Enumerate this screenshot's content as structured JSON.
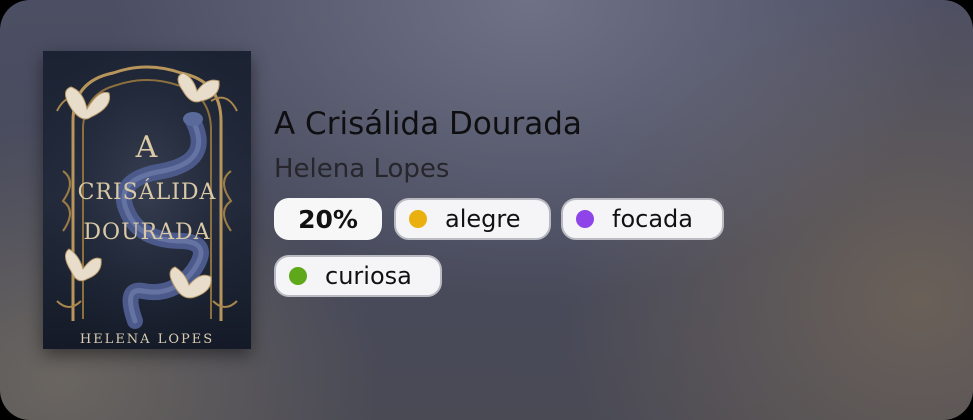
{
  "book": {
    "title": "A Crisálida Dourada",
    "author": "Helena Lopes",
    "cover": {
      "title_line1": "A",
      "title_line2": "CRISÁLIDA",
      "title_line3": "DOURADA",
      "author": "HELENA LOPES"
    }
  },
  "progress": {
    "label": "20%",
    "value": 0.2
  },
  "moods": [
    {
      "label": "alegre",
      "color": "#e9b010"
    },
    {
      "label": "focada",
      "color": "#8e44e8"
    },
    {
      "label": "curiosa",
      "color": "#5fa81a"
    }
  ]
}
